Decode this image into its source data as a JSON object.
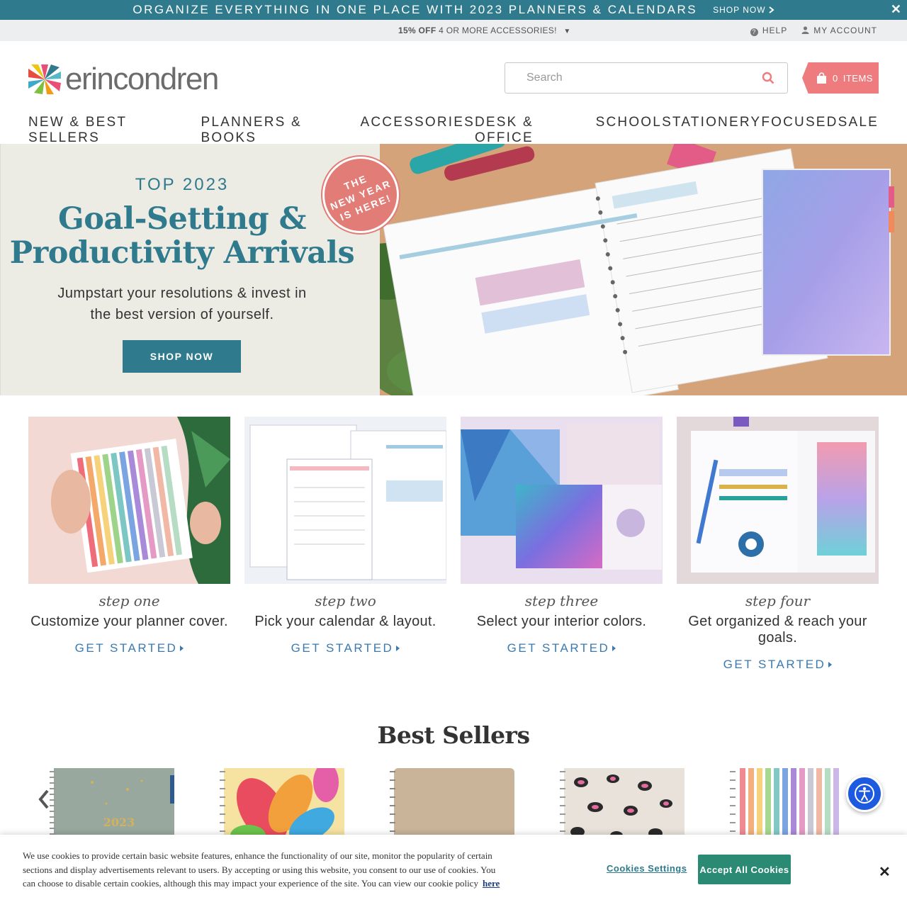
{
  "promo": {
    "text": "ORGANIZE EVERYTHING IN ONE PLACE WITH 2023 PLANNERS & CALENDARS",
    "shop": "SHOP NOW",
    "close": "✕"
  },
  "utility": {
    "offer_bold": "15% OFF",
    "offer_rest": "4 OR MORE ACCESSORIES!",
    "help": "HELP",
    "account": "MY ACCOUNT"
  },
  "header": {
    "logo_text": "erincondren",
    "search_placeholder": "Search",
    "cart_count": "0",
    "cart_label": "ITEMS"
  },
  "nav": [
    "NEW & BEST SELLERS",
    "PLANNERS & BOOKS",
    "ACCESSORIES",
    "DESK & OFFICE",
    "SCHOOL",
    "STATIONERY",
    "FOCUSED",
    "SALE"
  ],
  "hero": {
    "kicker": "TOP 2023",
    "title_line1": "Goal-Setting &",
    "title_line2": "Productivity Arrivals",
    "sub_line1": "Jumpstart your resolutions & invest in",
    "sub_line2": "the best version of yourself.",
    "button": "SHOP NOW",
    "badge_line1": "THE",
    "badge_line2": "NEW YEAR",
    "badge_line3": "IS HERE!"
  },
  "steps": [
    {
      "label": "step one",
      "desc": "Customize your planner cover.",
      "cta": "GET STARTED"
    },
    {
      "label": "step two",
      "desc": "Pick your calendar & layout.",
      "cta": "GET STARTED"
    },
    {
      "label": "step three",
      "desc": "Select your interior colors.",
      "cta": "GET STARTED"
    },
    {
      "label": "step four",
      "desc": "Get organized & reach your goals.",
      "cta": "GET STARTED"
    }
  ],
  "best_sellers": {
    "title": "Best Sellers",
    "cover_year": "2023"
  },
  "cookie": {
    "text": "We use cookies to provide certain basic website features, enhance the functionality of our site, monitor the popularity of certain sections and display advertisements relevant to users. By accepting or using this website, you consent to our use of cookies. You can choose to disable certain cookies, although this may impact your experience of the site. You can view our cookie policy",
    "link": "here",
    "settings": "Cookies Settings",
    "accept": "Accept All Cookies",
    "close": "✕"
  },
  "colors": {
    "teal": "#2f7a8c",
    "coral": "#ee7c7f",
    "link_blue": "#3b7ab0",
    "accept_green": "#2b8a74"
  }
}
